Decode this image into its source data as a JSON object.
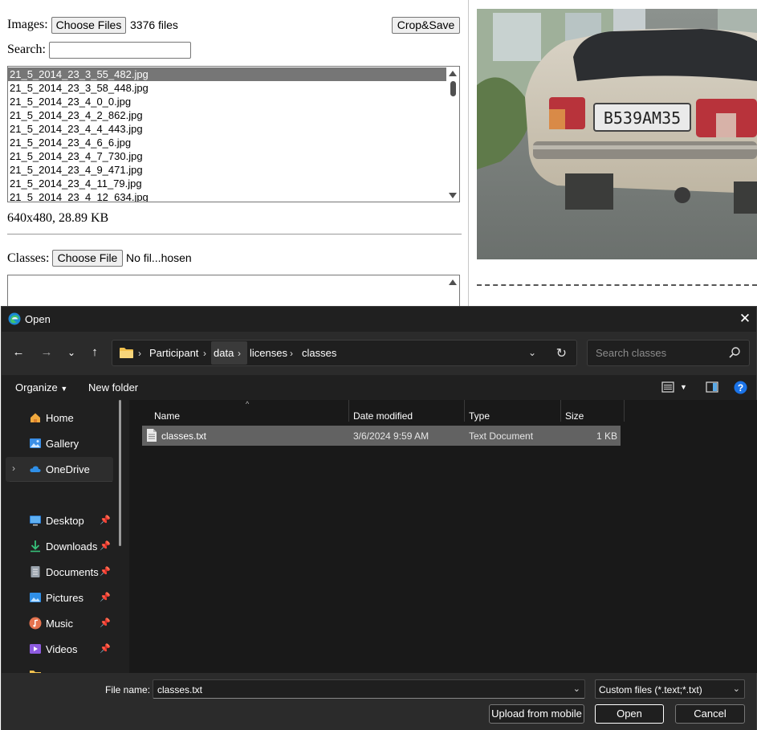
{
  "app": {
    "images_label": "Images:",
    "choose_files_label": "Choose Files",
    "files_count": "3376 files",
    "crop_save_label": "Crop&Save",
    "search_label": "Search:",
    "search_value": "",
    "file_list": [
      "21_5_2014_23_3_55_482.jpg",
      "21_5_2014_23_3_58_448.jpg",
      "21_5_2014_23_4_0_0.jpg",
      "21_5_2014_23_4_2_862.jpg",
      "21_5_2014_23_4_4_443.jpg",
      "21_5_2014_23_4_6_6.jpg",
      "21_5_2014_23_4_7_730.jpg",
      "21_5_2014_23_4_9_471.jpg",
      "21_5_2014_23_4_11_79.jpg",
      "21_5_2014_23_4_12_634.jpg"
    ],
    "selected_index": 0,
    "image_info": "640x480, 28.89 KB",
    "classes_label": "Classes:",
    "choose_file_label": "Choose File",
    "no_file_text": "No fil...hosen",
    "plate_text": "В539АМ35"
  },
  "dialog": {
    "title": "Open",
    "address": {
      "crumbs": [
        "Participant",
        "data",
        "licenses",
        "classes"
      ]
    },
    "search_placeholder": "Search classes",
    "toolbar": {
      "organize_label": "Organize",
      "new_folder_label": "New folder"
    },
    "sidebar": {
      "items": [
        {
          "label": "Home",
          "icon": "home-icon",
          "pinned": false
        },
        {
          "label": "Gallery",
          "icon": "gallery-icon",
          "pinned": false
        },
        {
          "label": "OneDrive",
          "icon": "cloud-icon",
          "pinned": false
        },
        {
          "label": "Desktop",
          "icon": "desktop-icon",
          "pinned": true
        },
        {
          "label": "Downloads",
          "icon": "download-icon",
          "pinned": true
        },
        {
          "label": "Documents",
          "icon": "documents-icon",
          "pinned": true
        },
        {
          "label": "Pictures",
          "icon": "pictures-icon",
          "pinned": true
        },
        {
          "label": "Music",
          "icon": "music-icon",
          "pinned": true
        },
        {
          "label": "Videos",
          "icon": "videos-icon",
          "pinned": true
        }
      ]
    },
    "columns": [
      "Name",
      "Date modified",
      "Type",
      "Size"
    ],
    "files": [
      {
        "name": "classes.txt",
        "date": "3/6/2024 9:59 AM",
        "type": "Text Document",
        "size": "1 KB"
      }
    ],
    "footer": {
      "file_name_label": "File name:",
      "file_name_value": "classes.txt",
      "filter_value": "Custom files (*.text;*.txt)",
      "upload_label": "Upload from mobile",
      "open_label": "Open",
      "cancel_label": "Cancel"
    },
    "colors": {
      "background": "#202020",
      "selection": "#626262",
      "accent": "#1a73e8"
    }
  }
}
